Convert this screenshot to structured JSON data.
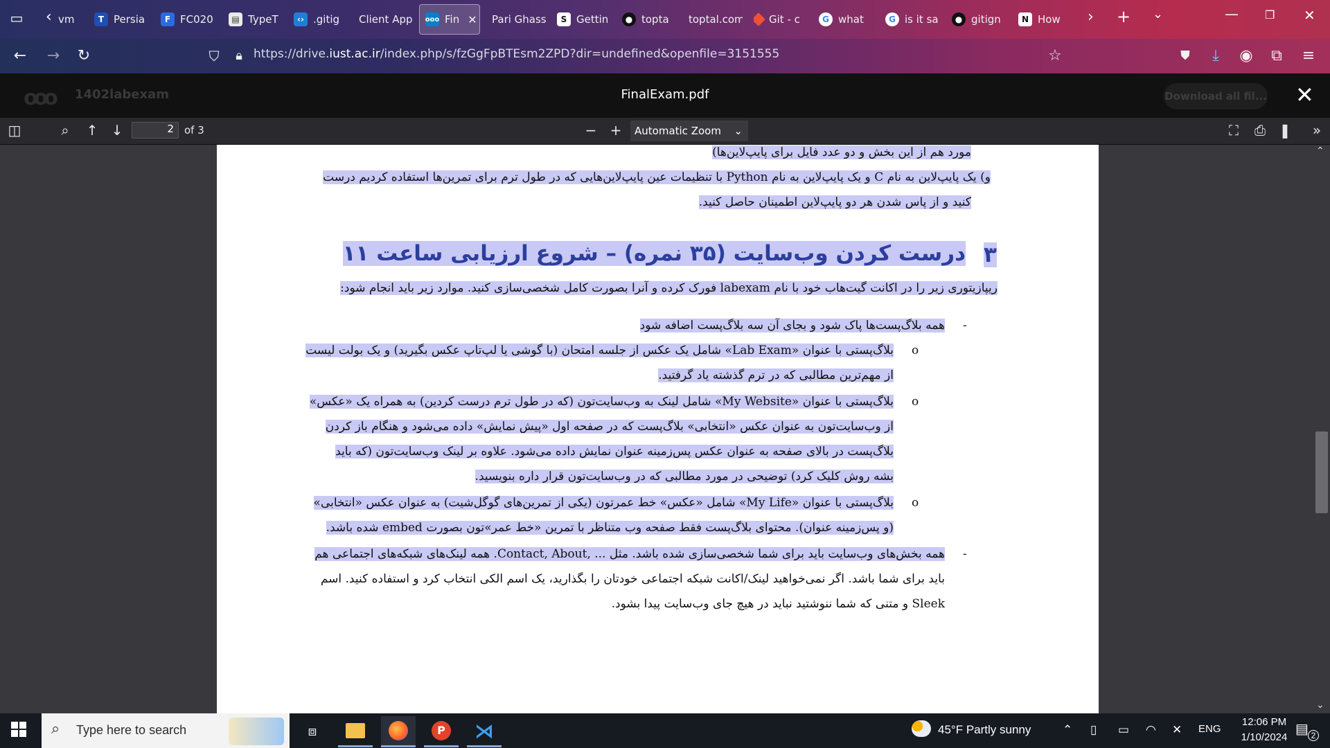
{
  "browser": {
    "tabs": [
      {
        "label": "vm",
        "icon": "generic-icon"
      },
      {
        "label": "Persia",
        "icon": "tf-icon"
      },
      {
        "label": "FC020",
        "icon": "fc-icon"
      },
      {
        "label": "TypeT",
        "icon": "page-icon"
      },
      {
        "label": ".gitig",
        "icon": "vscode-icon"
      },
      {
        "label": "Client App",
        "icon": ""
      },
      {
        "label": "Fin",
        "icon": "nextcloud-icon"
      },
      {
        "label": "Pari Ghass",
        "icon": ""
      },
      {
        "label": "Gettin",
        "icon": "s-icon"
      },
      {
        "label": "topta",
        "icon": "github-icon"
      },
      {
        "label": "toptal.com",
        "icon": ""
      },
      {
        "label": "Git - c",
        "icon": "git-icon"
      },
      {
        "label": "what",
        "icon": "google-icon"
      },
      {
        "label": "is it sa",
        "icon": "google-icon"
      },
      {
        "label": "gitign",
        "icon": "github-icon"
      },
      {
        "label": "How",
        "icon": "notion-icon"
      }
    ],
    "url_prefix": "https://drive.",
    "url_domain": "iust.ac.ir",
    "url_suffix": "/index.php/s/fzGgFpBTEsm2ZPD?dir=undefined&openfile=3151555"
  },
  "viewer_header": {
    "share_name": "1402labexam",
    "file_title": "FinalExam.pdf",
    "download_all": "Download all fil..."
  },
  "pdf_toolbar": {
    "page_number": "2",
    "page_count": "of 3",
    "zoom": "Automatic Zoom"
  },
  "document": {
    "lines": [
      "مورد هم از این بخش و دو عدد فایل برای پایپ‌لاین‌ها)",
      "و)   یک پایپ‌لاین به نام C و یک پایپ‌لاین به نام Python با تنظیمات عین پایپ‌لاین‌هایی که در طول ترم برای تمرین‌ها استفاده کردیم درست",
      "کنید و از پاس شدن هر دو پایپ‌لاین اطمینان حاصل کنید.",
      "ریپازیتوری زیر را در اکانت گیت‌هاب خود با نام labexam فورک کرده و آنرا بصورت کامل شخصی‌سازی کنید. موارد زیر باید انجام شود:",
      "همه بلاگ‌پست‌ها پاک شود و بجای آن سه بلاگ‌پست اضافه شود",
      "بلاگ‌پستی با عنوان «Lab Exam» شامل یک عکس از جلسه امتحان (با گوشی یا لپ‌تاپ عکس بگیرید) و یک بولت لیست",
      "از مهم‌ترین مطالبی که در ترم گذشته یاد گرفتید.",
      "بلاگ‌پستی با عنوان «My Website» شامل لینک به وب‌سایت‌تون (که در طول ترم درست کردین) به همراه یک «عکس»",
      "از وب‌سایت‌تون به عنوان عکس «انتخابی» بلاگ‌پست که در صفحه اول «پیش نمایش» داده می‌شود و هنگام باز کردن",
      "بلاگ‌پست در بالای صفحه به عنوان عکس پس‌زمینه عنوان نمایش داده می‌شود. علاوه بر لینک وب‌سایت‌تون (که باید",
      "بشه روش کلیک کرد) توضیحی در مورد مطالبی که در وب‌سایت‌تون قرار داره بنویسید.",
      "بلاگ‌پستی با عنوان «My Life» شامل «عکس» خط عمرتون (یکی از تمرین‌های گوگل‌شیت) به عنوان عکس «انتخابی»",
      "(و پس‌زمینه عنوان). محتوای بلاگ‌پست فقط صفحه وب متناظر با تمرین «خط عمر»تون بصورت embed شده باشد.",
      "همه بخش‌های وب‌سایت باید برای شما شخصی‌سازی شده باشد. مثل ... ,Contact, About. همه لینک‌های شبکه‌های اجتماعی هم",
      "باید برای شما باشد. اگر نمی‌خواهید لینک/اکانت شبکه اجتماعی خودتان را بگذارید، یک اسم الکی انتخاب کرد و استفاده کنید. اسم",
      "Sleek و متنی که شما ننوشتید نباید در هیچ جای وب‌سایت پیدا بشود."
    ],
    "heading_number": "۳",
    "heading": "درست کردن وب‌سایت (۳۵ نمره) – شروع ارزیابی ساعت ۱۱",
    "dash": "-",
    "bullet": "o"
  },
  "taskbar": {
    "search_placeholder": "Type here to search",
    "weather": "45°F  Partly sunny",
    "language": "ENG",
    "time": "12:06 PM",
    "date": "1/10/2024",
    "notifications": "2"
  },
  "colors": {
    "highlight": "#c9c9f5",
    "heading": "#2b3f9e"
  }
}
